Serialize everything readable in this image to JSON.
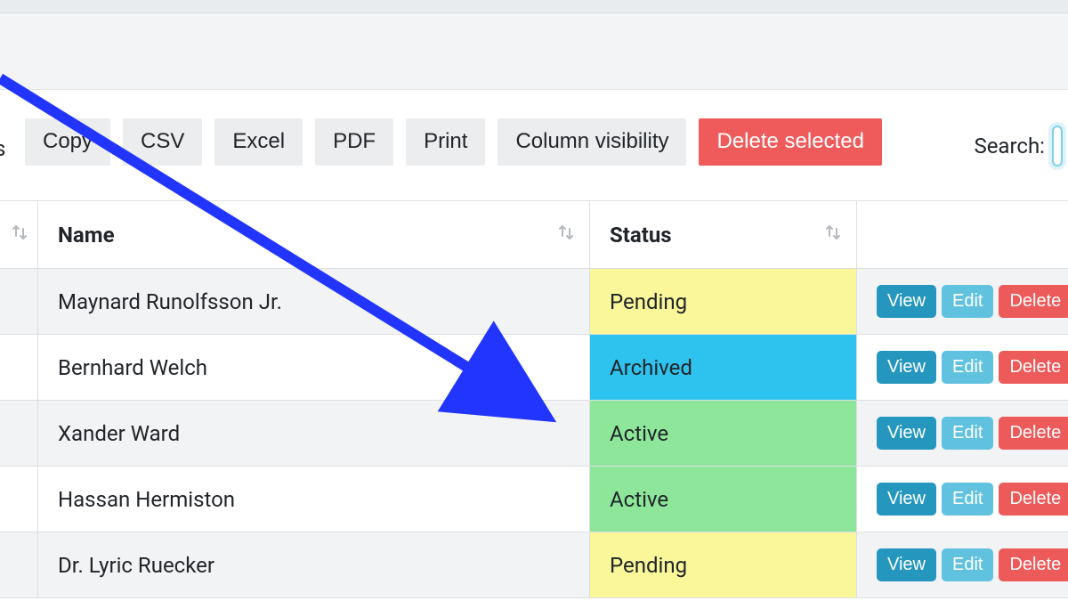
{
  "toolbar": {
    "entries_suffix": "s",
    "buttons": {
      "copy": "Copy",
      "csv": "CSV",
      "excel": "Excel",
      "pdf": "PDF",
      "print": "Print",
      "colvis": "Column visibility",
      "delete_selected": "Delete selected"
    },
    "search_label": "Search:"
  },
  "columns": {
    "name": "Name",
    "status": "Status"
  },
  "actions": {
    "view": "View",
    "edit": "Edit",
    "delete": "Delete"
  },
  "rows": [
    {
      "name": "Maynard Runolfsson Jr.",
      "status": "Pending",
      "status_class": "status-pending"
    },
    {
      "name": "Bernhard Welch",
      "status": "Archived",
      "status_class": "status-archived"
    },
    {
      "name": "Xander Ward",
      "status": "Active",
      "status_class": "status-active"
    },
    {
      "name": "Hassan Hermiston",
      "status": "Active",
      "status_class": "status-active"
    },
    {
      "name": "Dr. Lyric Ruecker",
      "status": "Pending",
      "status_class": "status-pending"
    }
  ]
}
